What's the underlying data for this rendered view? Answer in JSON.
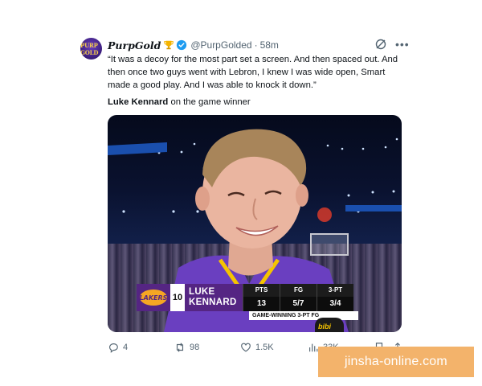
{
  "post": {
    "avatar": {
      "text": "PURP GOLD",
      "colors": {
        "bg": "#3a1d7a",
        "text": "#f2c94c"
      }
    },
    "display_name": "PurpGold",
    "badge_icon": "trophy-icon",
    "verified_icon": "verified-badge-icon",
    "handle": "@PurpGolded",
    "separator": "·",
    "time": "58m",
    "body": "“It was a decoy for the most part set a screen. And then spaced out. And then once two guys went with Lebron, I knew I was wide open, Smart made a good play. And I was able to knock it down.”",
    "attribution_name": "Luke Kennard",
    "attribution_rest": " on the game winner"
  },
  "media": {
    "lower_third": {
      "team": "LAKERS",
      "number": "10",
      "first_name": "LUKE",
      "last_name": "KENNARD",
      "stats": [
        {
          "label": "PTS",
          "value": "13"
        },
        {
          "label": "FG",
          "value": "5/7"
        },
        {
          "label": "3-PT",
          "value": "3/4"
        }
      ],
      "caption": "GAME-WINNING 3-PT FG"
    },
    "mic_label": "bibi"
  },
  "actions": {
    "replies": "4",
    "reposts": "98",
    "likes": "1.5K",
    "views": "33K"
  },
  "watermark": "jinsha-online.com",
  "colors": {
    "lakers_purple": "#552583",
    "lakers_gold": "#f5a623",
    "verified_blue": "#1d9bf0",
    "muted": "#536471",
    "watermark_bg": "#f3b36b"
  }
}
